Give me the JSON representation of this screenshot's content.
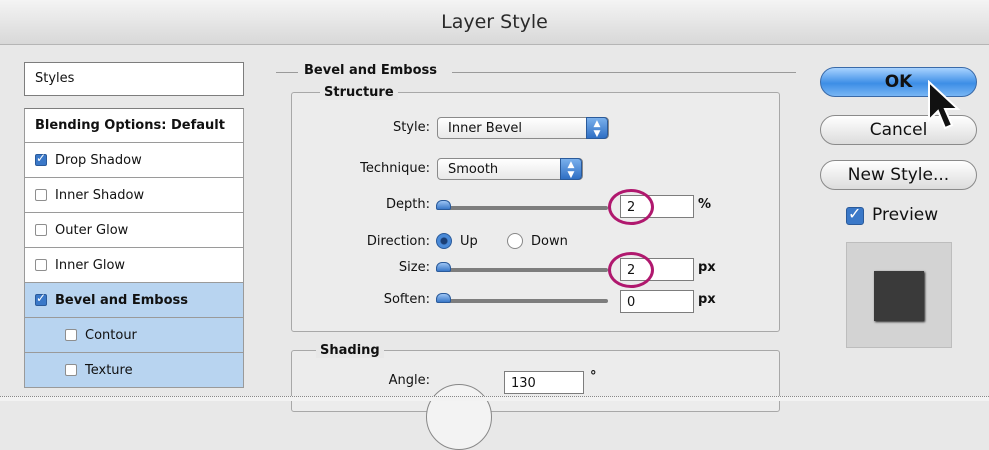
{
  "window": {
    "title": "Layer Style"
  },
  "styles_panel": {
    "header": "Styles",
    "items": [
      {
        "label": "Blending Options: Default",
        "checkbox": false,
        "checked": false
      },
      {
        "label": "Drop Shadow",
        "checkbox": true,
        "checked": true
      },
      {
        "label": "Inner Shadow",
        "checkbox": true,
        "checked": false
      },
      {
        "label": "Outer Glow",
        "checkbox": true,
        "checked": false
      },
      {
        "label": "Inner Glow",
        "checkbox": true,
        "checked": false
      },
      {
        "label": "Bevel and Emboss",
        "checkbox": true,
        "checked": true
      },
      {
        "label": "Contour",
        "checkbox": true,
        "checked": false
      },
      {
        "label": "Texture",
        "checkbox": true,
        "checked": false
      }
    ]
  },
  "bevel": {
    "title": "Bevel and Emboss",
    "structure_title": "Structure",
    "style_label": "Style:",
    "style_value": "Inner Bevel",
    "technique_label": "Technique:",
    "technique_value": "Smooth",
    "depth_label": "Depth:",
    "depth_value": "2",
    "depth_unit": "%",
    "direction_label": "Direction:",
    "direction_up": "Up",
    "direction_down": "Down",
    "direction_selected": "Up",
    "size_label": "Size:",
    "size_value": "2",
    "size_unit": "px",
    "soften_label": "Soften:",
    "soften_value": "0",
    "soften_unit": "px",
    "shading_title": "Shading",
    "angle_label": "Angle:",
    "angle_value": "130",
    "angle_unit": "°"
  },
  "buttons": {
    "ok": "OK",
    "cancel": "Cancel",
    "new_style": "New Style..."
  },
  "preview": {
    "label": "Preview",
    "checked": true
  },
  "colors": {
    "selected_row": "#b8d4f0",
    "highlight_ring": "#b0186e",
    "accent": "#3a78c8"
  }
}
